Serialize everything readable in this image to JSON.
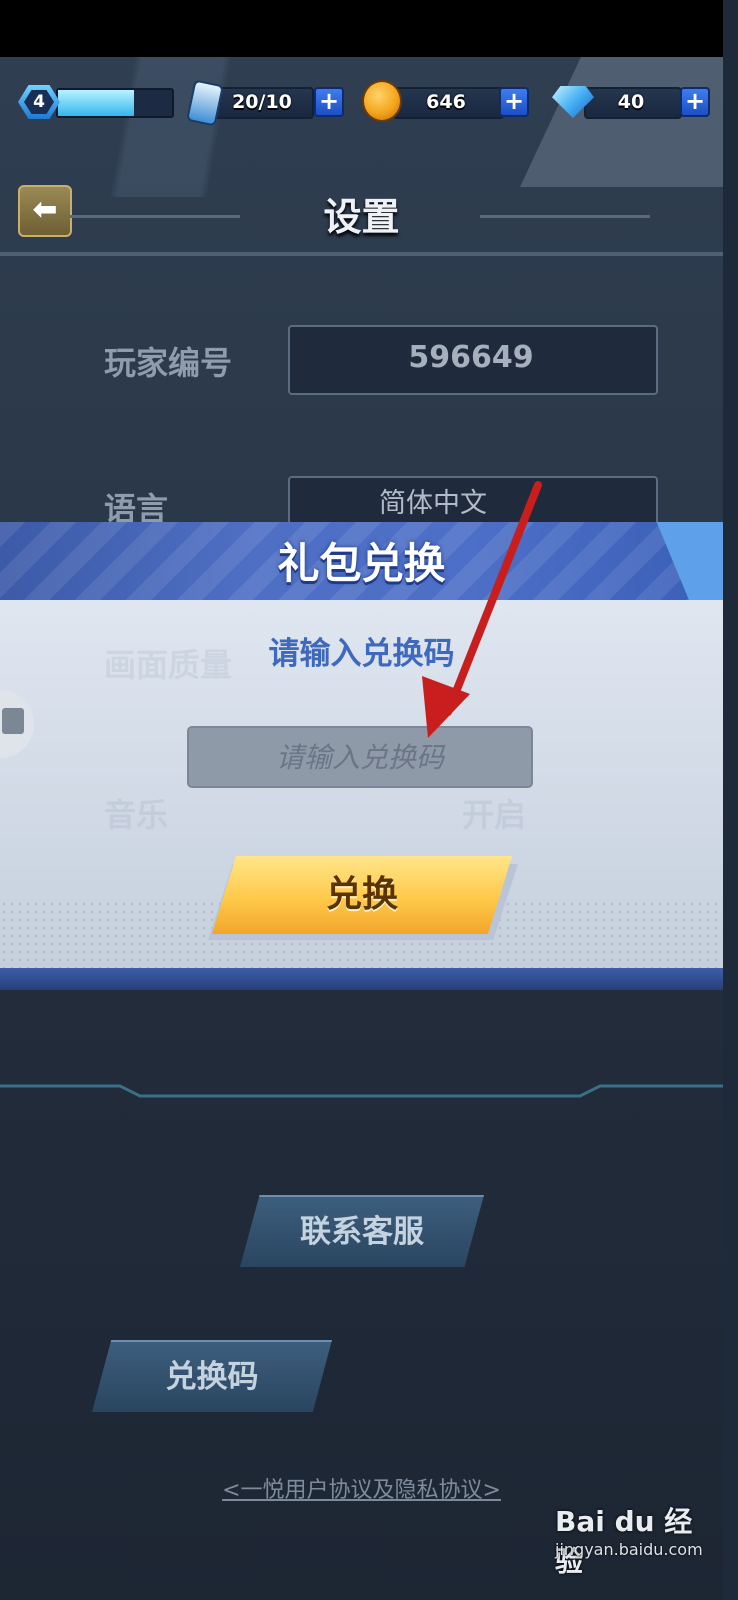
{
  "status_bar": {
    "level": "4",
    "xp_fill": 0.68,
    "energy": "20/10",
    "coins": "646",
    "gems": "40",
    "plus_label": "+"
  },
  "header": {
    "title": "设置",
    "back_icon": "arrow-left-icon"
  },
  "settings": {
    "player_id_label": "玩家编号",
    "player_id_value": "596649",
    "language_label": "语言",
    "language_value": "简体中文",
    "quality_label": "画面质量",
    "music_label": "音乐",
    "music_value": "开启"
  },
  "dialog": {
    "title": "礼包兑换",
    "prompt": "请输入兑换码",
    "input_placeholder": "请输入兑换码",
    "input_value": "",
    "redeem_button": "兑换"
  },
  "footer": {
    "support_button": "联系客服",
    "code_button": "兑换码",
    "agreement_link": "<一悦用户协议及隐私协议>"
  },
  "watermark": {
    "logo_text": "Bai du 经验",
    "url": "jingyan.baidu.com"
  },
  "colors": {
    "accent_blue": "#4e6fc4",
    "button_gold": "#ffc94a",
    "arrow_red": "#c81e1e"
  }
}
